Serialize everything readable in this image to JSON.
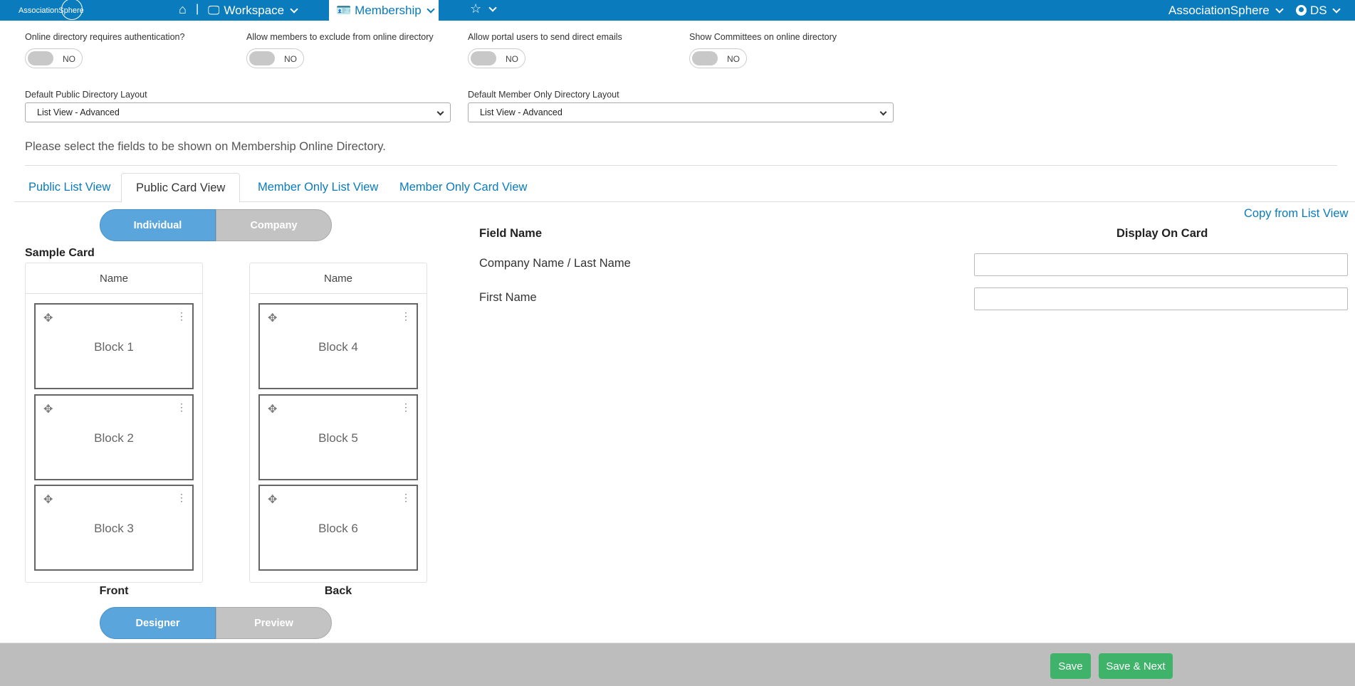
{
  "topbar": {
    "logo_text": "AssociationSphere",
    "workspace_label": "Workspace",
    "membership_label": "Membership",
    "org_label": "AssociationSphere",
    "user_initials": "DS",
    "separator": "|"
  },
  "settings": [
    {
      "label": "Online directory requires authentication?",
      "value": "NO"
    },
    {
      "label": "Allow members to exclude from online directory",
      "value": "NO"
    },
    {
      "label": "Allow portal users to send direct emails",
      "value": "NO"
    },
    {
      "label": "Show Committees on online directory",
      "value": "NO"
    }
  ],
  "layouts": {
    "public_label": "Default Public Directory Layout",
    "public_value": "List View - Advanced",
    "member_label": "Default Member Only Directory Layout",
    "member_value": "List View - Advanced"
  },
  "instruction": "Please select the fields to be shown on Membership Online Directory.",
  "tabs": [
    "Public List View",
    "Public Card View",
    "Member Only List View",
    "Member Only Card View"
  ],
  "active_tab": "Public Card View",
  "entity_toggle": {
    "on": "Individual",
    "off": "Company"
  },
  "sample_card_title": "Sample Card",
  "cards": {
    "front": {
      "header": "Name",
      "blocks": [
        "Block 1",
        "Block 2",
        "Block 3"
      ],
      "label": "Front"
    },
    "back": {
      "header": "Name",
      "blocks": [
        "Block 4",
        "Block 5",
        "Block 6"
      ],
      "label": "Back"
    }
  },
  "mode_toggle": {
    "on": "Designer",
    "off": "Preview"
  },
  "fields": {
    "copy_link": "Copy from List View",
    "col_name": "Field Name",
    "col_display": "Display On Card",
    "rows": [
      {
        "name": "Company Name / Last Name",
        "value": ""
      },
      {
        "name": "First Name",
        "value": ""
      }
    ]
  },
  "footer": {
    "save": "Save",
    "save_next": "Save & Next"
  },
  "colors": {
    "brand": "#0a7bbd",
    "toggle_on": "#5aa6dc",
    "save": "#3fb36a"
  }
}
